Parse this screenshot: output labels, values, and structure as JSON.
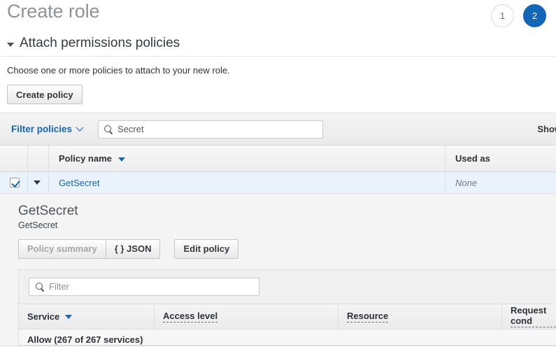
{
  "header": {
    "title": "Create role",
    "steps": [
      {
        "label": "1",
        "state": "inactive"
      },
      {
        "label": "2",
        "state": "active"
      }
    ]
  },
  "section": {
    "title": "Attach permissions policies",
    "description": "Choose one or more policies to attach to your new role.",
    "create_policy_label": "Create policy"
  },
  "filter_bar": {
    "filter_policies_label": "Filter policies",
    "search_value": "Secret",
    "search_placeholder": "Search",
    "showing_label": "Show"
  },
  "policy_table": {
    "columns": [
      "Policy name",
      "Used as"
    ],
    "rows": [
      {
        "checked": true,
        "name": "GetSecret",
        "used_as": "None"
      }
    ]
  },
  "detail": {
    "title": "GetSecret",
    "subtitle": "GetSecret",
    "tabs": [
      {
        "label": "Policy summary",
        "active": true
      },
      {
        "label": "{ } JSON",
        "active": false
      }
    ],
    "edit_label": "Edit policy",
    "filter_placeholder": "Filter",
    "columns": [
      "Service",
      "Access level",
      "Resource",
      "Request cond"
    ],
    "allow_summary": "Allow (267 of 267 services)"
  },
  "colors": {
    "accent": "#1166bb",
    "step_active": "#1266b8",
    "row_selected": "#eaf3fb",
    "panel_bg": "#f4f4f4"
  }
}
